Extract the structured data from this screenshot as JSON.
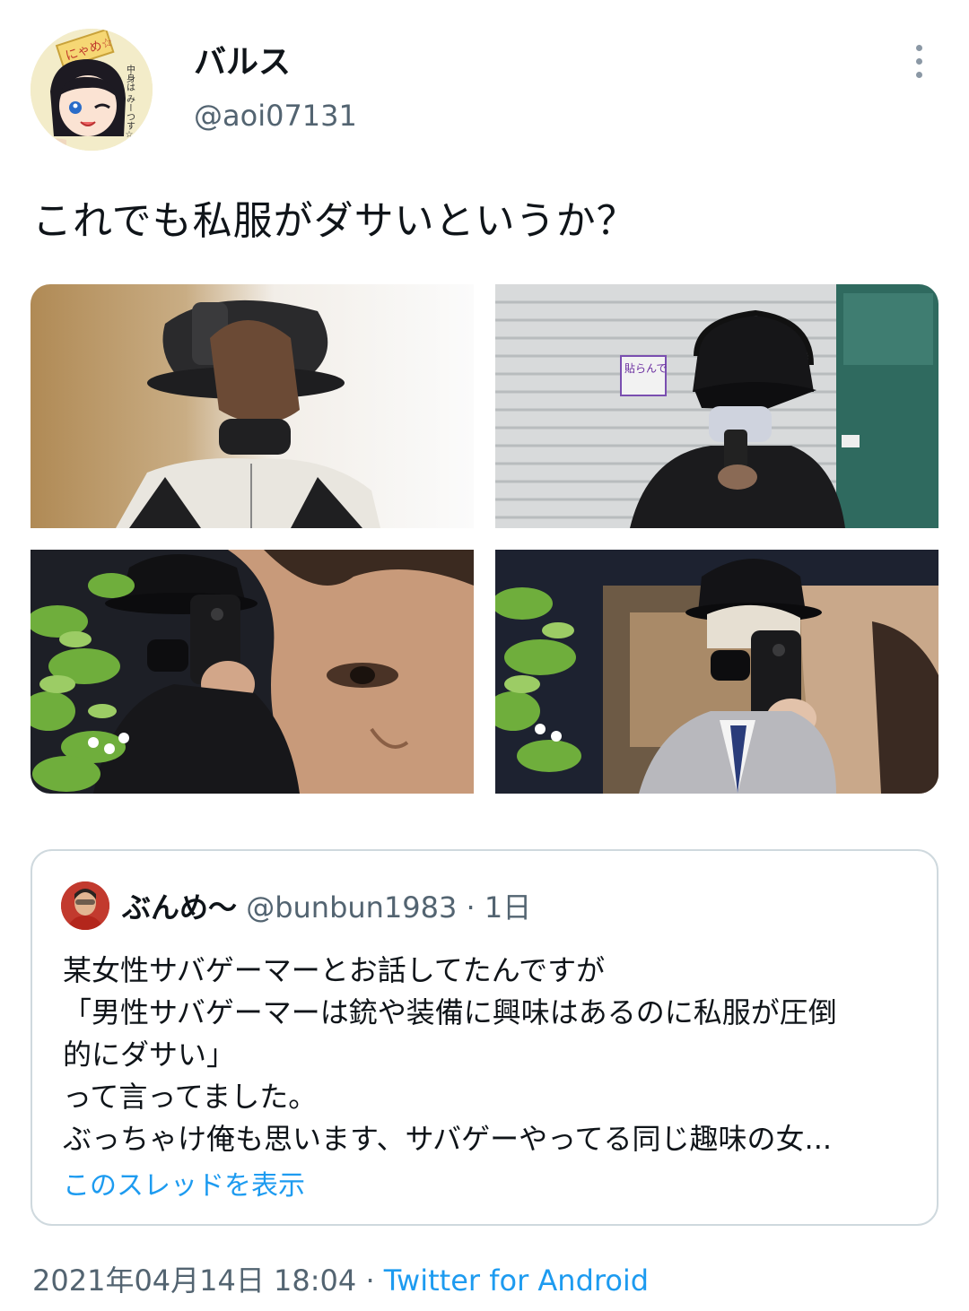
{
  "tweet": {
    "display_name": "バルス",
    "handle": "@aoi07131",
    "text": "これでも私服がダサいというか？",
    "avatar_sign_text": "にゃめ☆",
    "avatar_side_text": "中身は みーつす☆",
    "date": "2021年04月14日 18:04",
    "separator": "·",
    "client": "Twitter for Android",
    "more_icon": "more-vertical-icon"
  },
  "media": {
    "photos": [
      "photo-1",
      "photo-2",
      "photo-3",
      "photo-4"
    ],
    "photo2_sign_text": "貼らんで"
  },
  "quote": {
    "display_name": "ぶんめ〜",
    "handle": "@bunbun1983",
    "separator": "·",
    "time": "1日",
    "lines": [
      "某女性サバゲーマーとお話してたんですが",
      "「男性サバゲーマーは銃や装備に興味はあるのに私服が圧倒",
      "的にダサい」",
      "って言ってました。",
      "ぶっちゃけ俺も思います、サバゲーやってる同じ趣味の女..."
    ],
    "show_thread": "このスレッドを表示"
  }
}
